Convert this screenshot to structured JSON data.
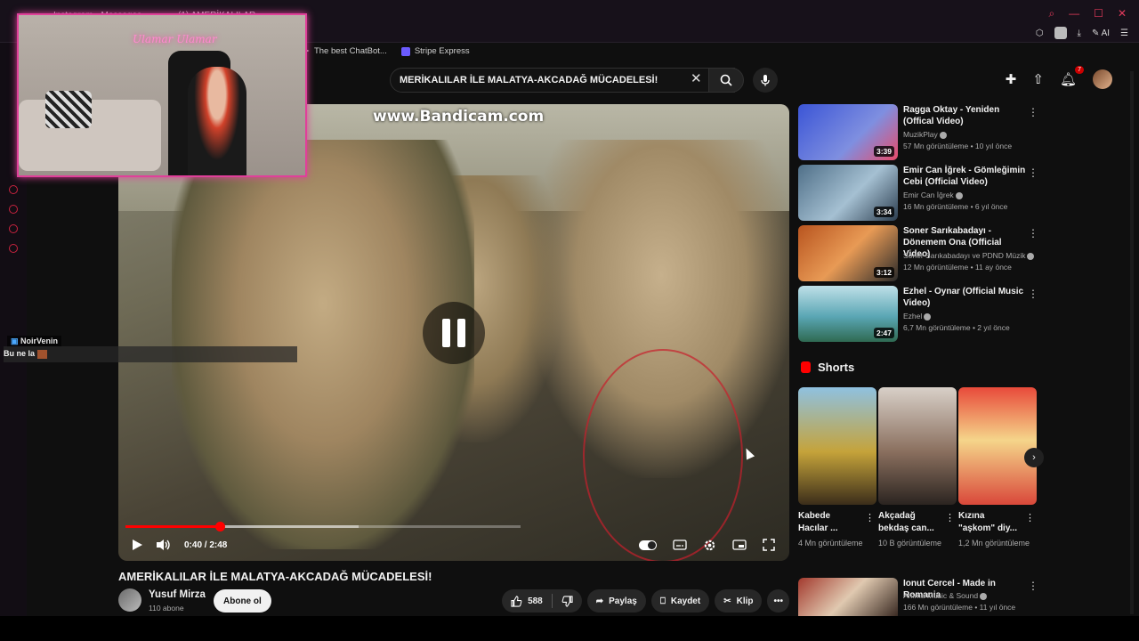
{
  "browser": {
    "tabs": [
      "Instagram • Messages",
      "(1) AMERİKALILAR..."
    ],
    "bookmarks": [
      {
        "label": "The best ChatBot..."
      },
      {
        "label": "Stripe Express"
      }
    ],
    "toolbar": {
      "ai_label": "AI"
    }
  },
  "search": {
    "query": "MERİKALILAR İLE MALATYA-AKCADAĞ MÜCADELESİ!"
  },
  "header": {
    "notification_count": "7"
  },
  "player": {
    "watermark": "www.Bandicam.com",
    "time": "0:40 / 2:48",
    "progress": 0.238,
    "buffered": 0.59
  },
  "overlay": {
    "neon_text": "Ulamar Ulamar",
    "chat_user": "NoirVenin",
    "chat_message": "Bu ne la"
  },
  "video": {
    "title": "AMERİKALILAR İLE MALATYA-AKCADAĞ MÜCADELESİ!",
    "channel": "Yusuf Mirza",
    "subscribers": "110 abone",
    "subscribe_label": "Abone ol",
    "likes": "588",
    "share_label": "Paylaş",
    "save_label": "Kaydet",
    "clip_label": "Klip"
  },
  "recommendations": [
    {
      "title": "Ragga Oktay - Yeniden (Offical Video)",
      "channel": "MuzikPlay",
      "meta": "57 Mn görüntüleme • 10 yıl önce",
      "duration": "3:39",
      "color": "#4a63c9"
    },
    {
      "title": "Emir Can İğrek - Gömleğimin Cebi (Official Video)",
      "channel": "Emir Can İğrek",
      "meta": "16 Mn görüntüleme • 6 yıl önce",
      "duration": "3:34",
      "color": "#6d8da3"
    },
    {
      "title": "Soner Sarıkabadayı - Dönemem Ona (Official Video)",
      "channel": "Soner Sarıkabadayı ve PDND Müzik",
      "meta": "12 Mn görüntüleme • 11 ay önce",
      "duration": "3:12",
      "color": "#c9672e"
    },
    {
      "title": "Ezhel - Oynar (Official Music Video)",
      "channel": "Ezhel",
      "meta": "6,7 Mn görüntüleme • 2 yıl önce",
      "duration": "2:47",
      "color": "#5aa6b4"
    }
  ],
  "shorts": {
    "header": "Shorts",
    "items": [
      {
        "title": "Kabede Hacılar ...",
        "views": "4 Mn görüntüleme",
        "color": "#c5a33a"
      },
      {
        "title": "Akçadağ bekdaş can...",
        "views": "10 B görüntüleme",
        "color": "#8a6f5e"
      },
      {
        "title": "Kızına \"aşkom\" diy...",
        "views": "1,2 Mn görüntüleme",
        "color": "#d9483a"
      }
    ]
  },
  "bottom_rec": {
    "title": "Ionut Cercel - Made in Romania",
    "channel": "Amma Music & Sound",
    "meta": "166 Mn görüntüleme • 11 yıl önce",
    "color": "#a33a2e"
  },
  "sidebar_label": "GX"
}
